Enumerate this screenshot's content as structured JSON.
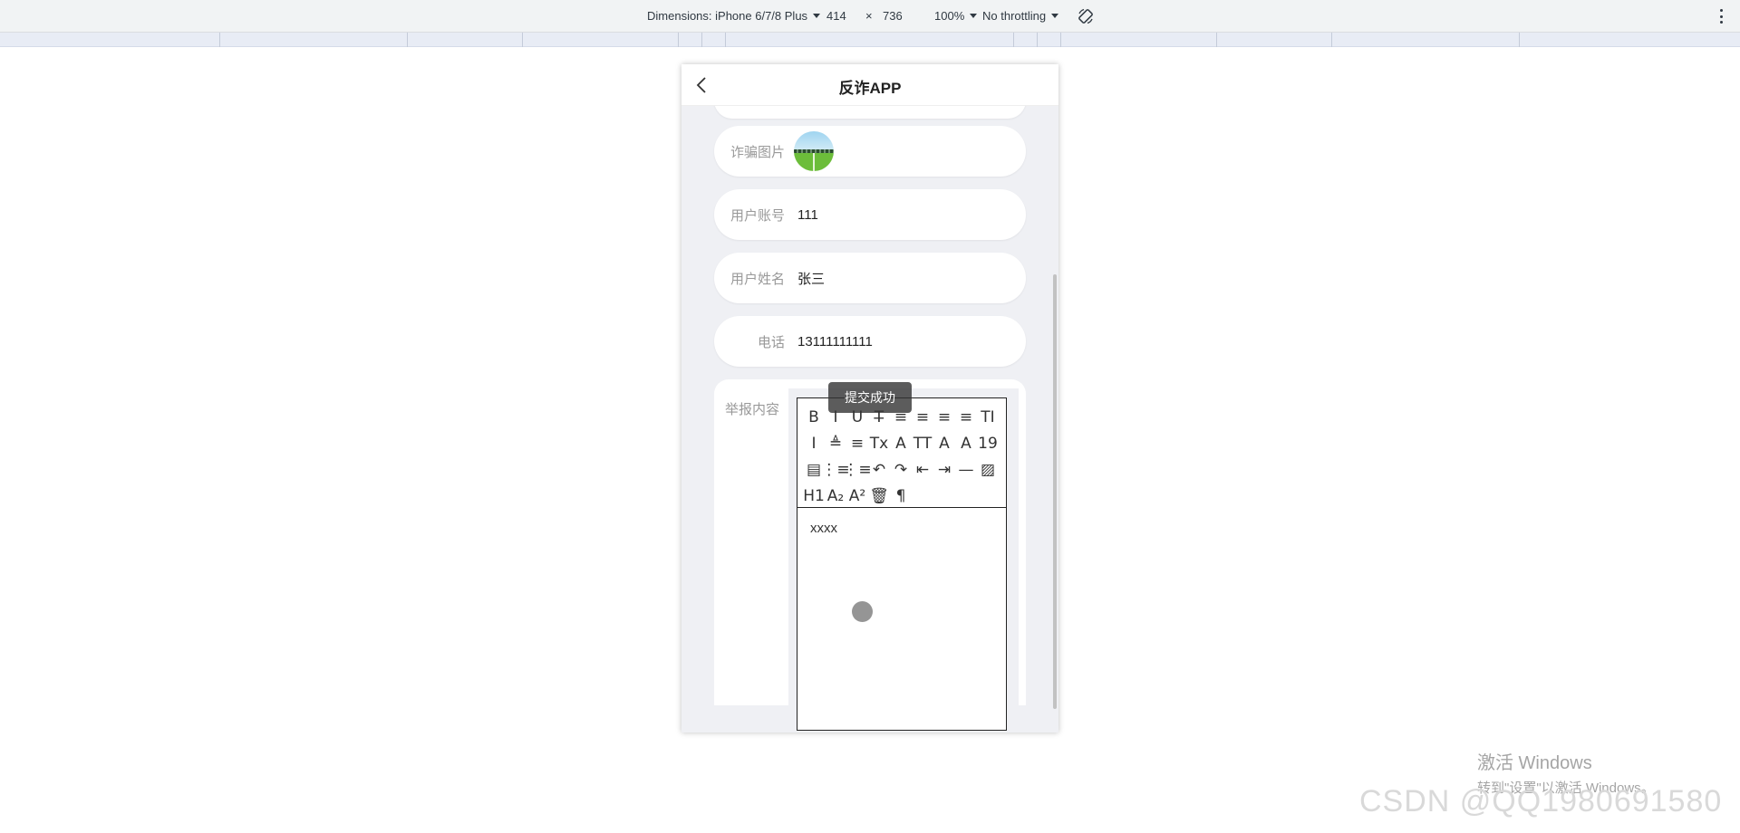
{
  "devtools": {
    "dimensions_label": "Dimensions: iPhone 6/7/8 Plus",
    "width": "414",
    "times": "×",
    "height": "736",
    "zoom": "100%",
    "throttling": "No throttling",
    "rotate_icon": "rotate-icon",
    "more_icon": "kebab-icon"
  },
  "app": {
    "title": "反诈APP",
    "back_icon": "chevron-left-icon"
  },
  "form": {
    "photo_label": "诈骗图片",
    "account_label": "用户账号",
    "account_value": "111",
    "name_label": "用户姓名",
    "name_value": "张三",
    "phone_label": "电话",
    "phone_value": "13111111111",
    "report_label": "举报内容",
    "report_content": "xxxx"
  },
  "toast": "提交成功",
  "toolbar_rows": [
    [
      "B",
      "I",
      "U",
      "T̶",
      "≡",
      "≡",
      "≡",
      "≡",
      "TI"
    ],
    [
      "I",
      "≜",
      "≡",
      "Tx",
      "A",
      "TT",
      "A",
      "A",
      "19"
    ],
    [
      "▤",
      "⋮≡",
      "⋮≡",
      "↶",
      "↷",
      "⇤",
      "⇥",
      "—",
      "▨"
    ],
    [
      "H1",
      "A₂",
      "A²",
      "🗑",
      "¶"
    ]
  ],
  "watermark": {
    "windows_line1": "激活 Windows",
    "windows_line2": "转到\"设置\"以激活 Windows。",
    "csdn": "CSDN @QQ1980691580"
  }
}
